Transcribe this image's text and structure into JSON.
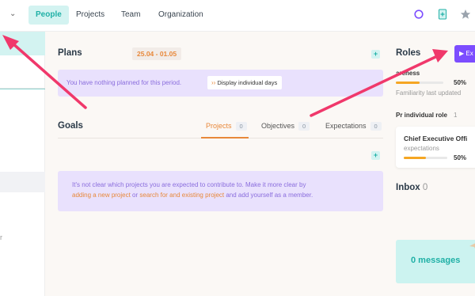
{
  "nav": {
    "tabs": [
      {
        "label": "People",
        "active": true
      },
      {
        "label": "Projects",
        "active": false
      },
      {
        "label": "Team",
        "active": false
      },
      {
        "label": "Organization",
        "active": false
      }
    ],
    "icons": [
      "chevron-down-icon",
      "search-icon",
      "document-plus-icon",
      "star-icon"
    ]
  },
  "sidebar": {
    "mark": "r"
  },
  "plans": {
    "title": "Plans",
    "date_range": "25.04 - 01.05",
    "empty_text": "You have nothing planned for this period.",
    "display_button": "Display individual days"
  },
  "goals": {
    "title": "Goals",
    "tabs": [
      {
        "label": "Projects",
        "count": "0",
        "active": true
      },
      {
        "label": "Objectives",
        "count": "0",
        "active": false
      },
      {
        "label": "Expectations",
        "count": "0",
        "active": false
      }
    ],
    "message": {
      "line1": "It's not clear which projects you are expected to contribute to. Make it more clear by",
      "link1": "adding a new project",
      "mid": " or ",
      "link2": "search for and existing project",
      "end": " and add yourself as a member."
    }
  },
  "roles": {
    "title": "Roles",
    "action_label": "Ex",
    "summary_label": "areness",
    "summary_percent": "50%",
    "summary_value": 0.5,
    "familiarity_text": "Familiarity last updated",
    "individual_role_label": "Pr individual role",
    "individual_role_count": "1",
    "card": {
      "title": "Chief Executive Offi",
      "subtitle": "expectations",
      "percent": "50%",
      "value": 0.5
    }
  },
  "inbox": {
    "title": "Inbox",
    "count": "0",
    "messages_label": "0 messages"
  },
  "colors": {
    "accent_teal": "#1fb0a6",
    "accent_purple": "#7c4dff",
    "accent_orange": "#e8883a",
    "arrow_pink": "#f0386b"
  }
}
